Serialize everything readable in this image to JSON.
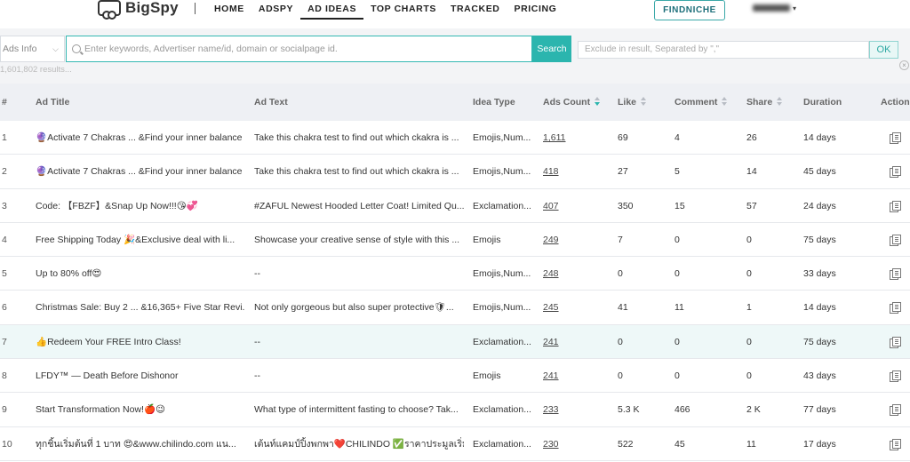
{
  "header": {
    "brand": "BigSpy",
    "nav": [
      "HOME",
      "ADSPY",
      "AD IDEAS",
      "TOP CHARTS",
      "TRACKED",
      "PRICING"
    ],
    "active_nav": "AD IDEAS",
    "findniche_label": "FINDNICHE",
    "user_name": "",
    "user_icon": "chevron-down-icon"
  },
  "search": {
    "scope_value": "Ads Info",
    "placeholder": "Enter keywords, Advertiser name/id, domain or socialpage id.",
    "button_label": "Search",
    "exclude_placeholder": "Exclude in result, Separated by \",\"",
    "ok_label": "OK",
    "results_text": "1,601,802 results..."
  },
  "table": {
    "columns": [
      "#",
      "Ad Title",
      "Ad Text",
      "Idea Type",
      "Ads Count",
      "Like",
      "Comment",
      "Share",
      "Duration",
      "Action"
    ],
    "sort_active_column": "Ads Count",
    "rows": [
      {
        "n": "1",
        "title": "🔮Activate 7 Chakras ... &Find your inner balance",
        "text": "Take this chakra test to find out which ckakra is ...",
        "type": "Emojis,Num...",
        "count": "1,611",
        "like": "69",
        "comment": "4",
        "share": "26",
        "duration": "14 days"
      },
      {
        "n": "2",
        "title": "🔮Activate 7 Chakras ... &Find your inner balance",
        "text": "Take this chakra test to find out which ckakra is ...",
        "type": "Emojis,Num...",
        "count": "418",
        "like": "27",
        "comment": "5",
        "share": "14",
        "duration": "45 days"
      },
      {
        "n": "3",
        "title": "Code: 【FBZF】&Snap Up Now!!!😘💞",
        "text": "#ZAFUL Newest Hooded Letter Coat! Limited Qu...",
        "type": "Exclamation...",
        "count": "407",
        "like": "350",
        "comment": "15",
        "share": "57",
        "duration": "24 days"
      },
      {
        "n": "4",
        "title": "Free Shipping Today 🎉&Exclusive deal with li...",
        "text": "Showcase your creative sense of style with this ...",
        "type": "Emojis",
        "count": "249",
        "like": "7",
        "comment": "0",
        "share": "0",
        "duration": "75 days"
      },
      {
        "n": "5",
        "title": "Up to 80% off😍",
        "text": "--",
        "type": "Emojis,Num...",
        "count": "248",
        "like": "0",
        "comment": "0",
        "share": "0",
        "duration": "33 days"
      },
      {
        "n": "6",
        "title": "Christmas Sale: Buy 2 ... &16,365+ Five Star Revi...",
        "text": "Not only gorgeous but also super protective🛡...",
        "type": "Emojis,Num...",
        "count": "245",
        "like": "41",
        "comment": "11",
        "share": "1",
        "duration": "14 days"
      },
      {
        "n": "7",
        "title": "👍Redeem Your FREE Intro Class!",
        "text": "--",
        "type": "Exclamation...",
        "count": "241",
        "like": "0",
        "comment": "0",
        "share": "0",
        "duration": "75 days"
      },
      {
        "n": "8",
        "title": "LFDY™ — Death Before Dishonor",
        "text": "--",
        "type": "Emojis",
        "count": "241",
        "like": "0",
        "comment": "0",
        "share": "0",
        "duration": "43 days"
      },
      {
        "n": "9",
        "title": "Start Transformation Now!🍎😉",
        "text": "What type of intermittent fasting to choose? Tak...",
        "type": "Exclamation...",
        "count": "233",
        "like": "5.3 K",
        "comment": "466",
        "share": "2 K",
        "duration": "77 days"
      },
      {
        "n": "10",
        "title": "ทุกชิ้นเริ่มต้นที่ 1 บาท 😍&www.chilindo.com แน...",
        "text": "เต้นท์แคมป์ปิ้งพกพา❤️CHILINDO ✅ราคาประมูลเริ่ม...",
        "type": "Exclamation...",
        "count": "230",
        "like": "522",
        "comment": "45",
        "share": "11",
        "duration": "17 days"
      }
    ]
  },
  "colors": {
    "accent": "#2bb5ae",
    "header_bg": "#eef0f4",
    "highlight_row": "#eef8f8"
  }
}
